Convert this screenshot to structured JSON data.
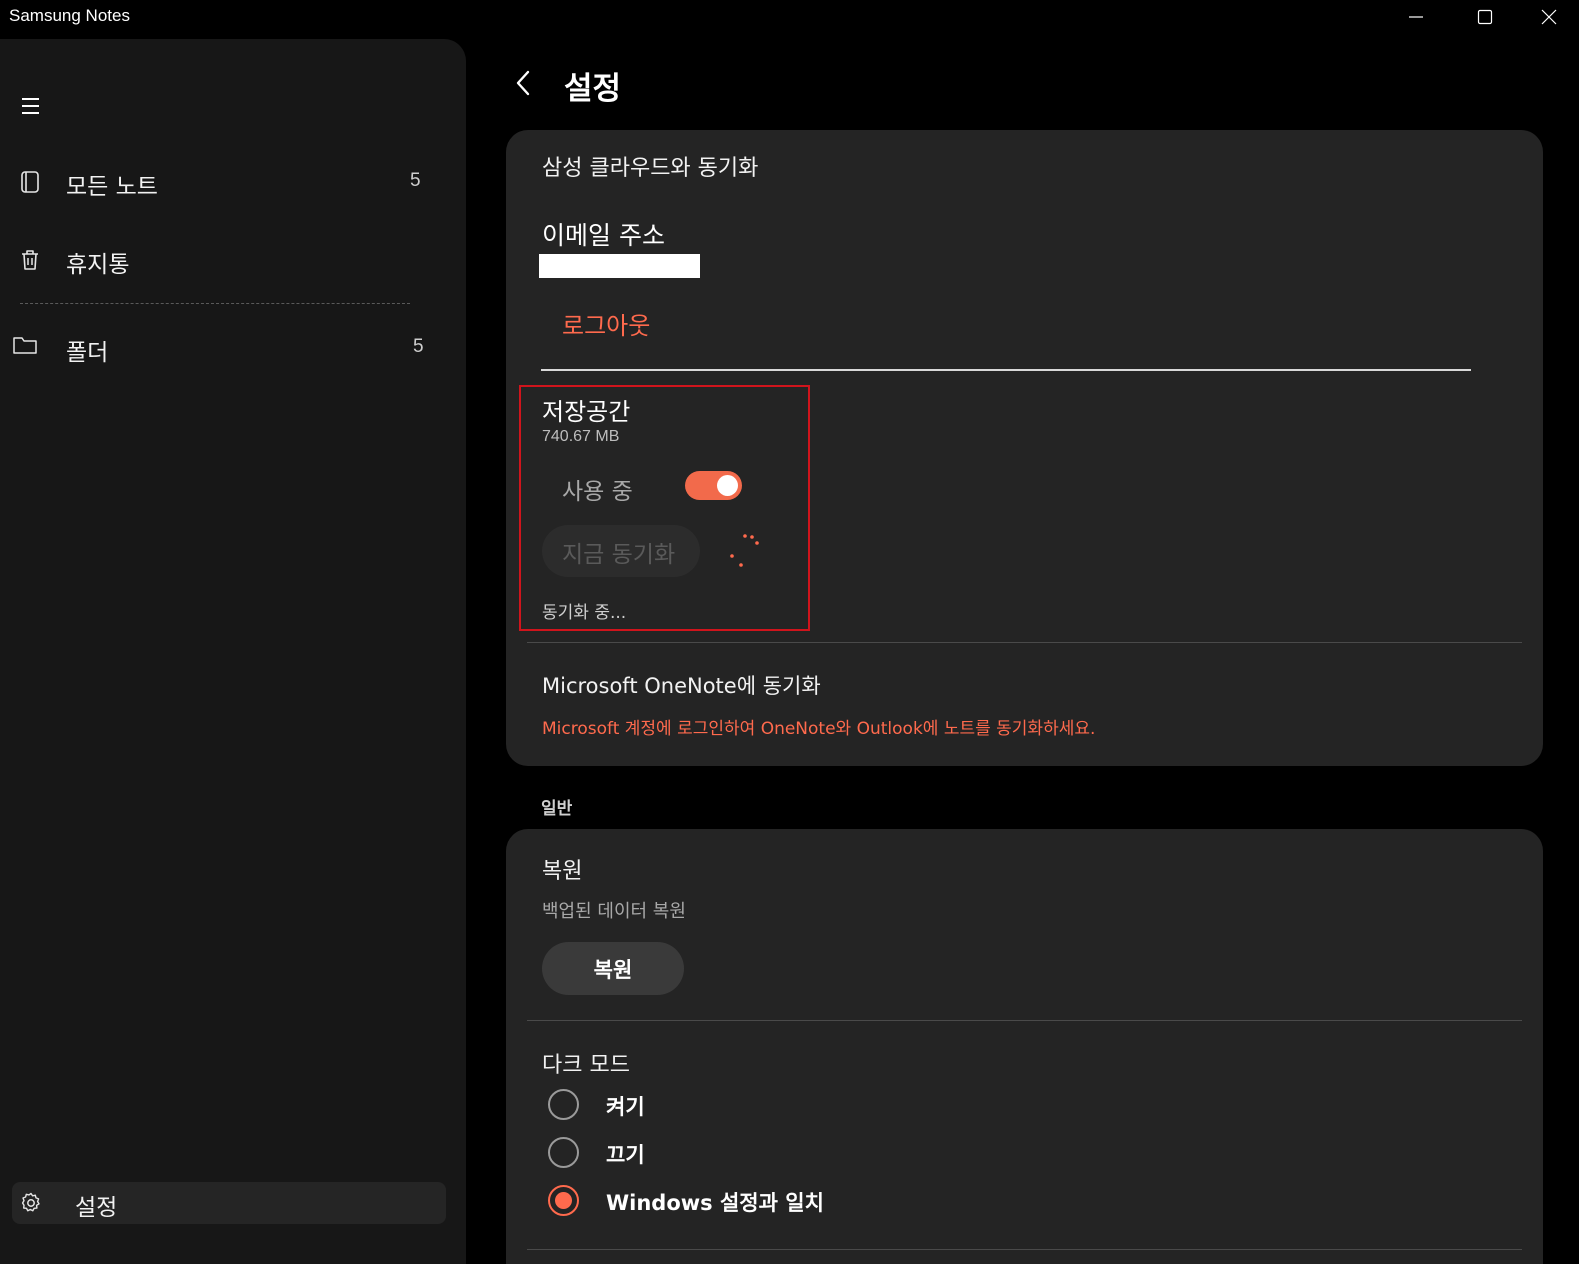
{
  "window": {
    "title": "Samsung Notes"
  },
  "sidebar": {
    "items": [
      {
        "label": "모든 노트",
        "count": "5",
        "icon": "notebook-icon"
      },
      {
        "label": "휴지통",
        "icon": "trash-icon"
      },
      {
        "label": "폴더",
        "count": "5",
        "icon": "folder-icon"
      }
    ],
    "settings_label": "설정"
  },
  "header": {
    "title": "설정"
  },
  "sync": {
    "title": "삼성 클라우드와 동기화",
    "email_label": "이메일 주소",
    "logout_label": "로그아웃",
    "storage_title": "저장공간",
    "storage_size": "740.67 MB",
    "in_use_label": "사용 중",
    "in_use_on": true,
    "sync_now_label": "지금 동기화",
    "syncing_label": "동기화 중...",
    "onenote_title": "Microsoft OneNote에 동기화",
    "onenote_desc": "Microsoft 계정에 로그인하여 OneNote와 Outlook에 노트를 동기화하세요."
  },
  "general": {
    "section_label": "일반",
    "restore_title": "복원",
    "restore_sub": "백업된 데이터 복원",
    "restore_button": "복원",
    "dark_mode_title": "다크 모드",
    "dark_mode_options": [
      {
        "label": "켜기",
        "selected": false
      },
      {
        "label": "끄기",
        "selected": false
      },
      {
        "label": "Windows 설정과 일치",
        "selected": true
      }
    ]
  },
  "colors": {
    "accent": "#ff6a4d",
    "highlight_border": "#d0141c",
    "card_bg": "#242424",
    "sidebar_bg": "#171717"
  }
}
